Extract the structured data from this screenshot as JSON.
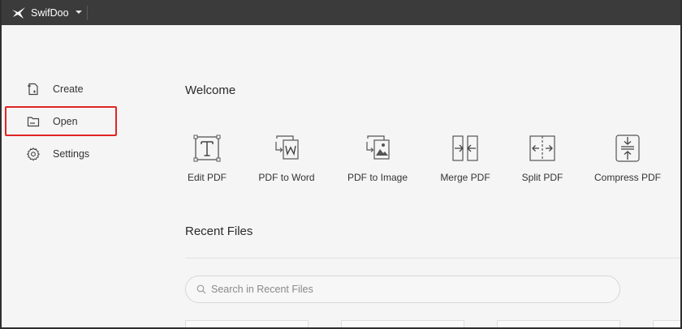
{
  "app": {
    "name": "SwifDoo",
    "logo_icon": "swift-bird-icon",
    "menu_icon": "caret-down-icon"
  },
  "sidebar": {
    "items": [
      {
        "label": "Create",
        "icon": "create-file-icon"
      },
      {
        "label": "Open",
        "icon": "folder-open-icon",
        "highlighted": true
      },
      {
        "label": "Settings",
        "icon": "gear-icon"
      }
    ],
    "highlight_color": "#e02424"
  },
  "main": {
    "welcome_title": "Welcome",
    "tools": [
      {
        "label": "Edit PDF",
        "icon": "edit-text-icon"
      },
      {
        "label": "PDF to Word",
        "icon": "pdf-to-word-icon"
      },
      {
        "label": "PDF to Image",
        "icon": "pdf-to-image-icon"
      },
      {
        "label": "Merge PDF",
        "icon": "merge-pdf-icon"
      },
      {
        "label": "Split PDF",
        "icon": "split-pdf-icon"
      },
      {
        "label": "Compress PDF",
        "icon": "compress-pdf-icon"
      }
    ],
    "recent_title": "Recent Files",
    "search": {
      "placeholder": "Search in Recent Files",
      "value": ""
    }
  }
}
